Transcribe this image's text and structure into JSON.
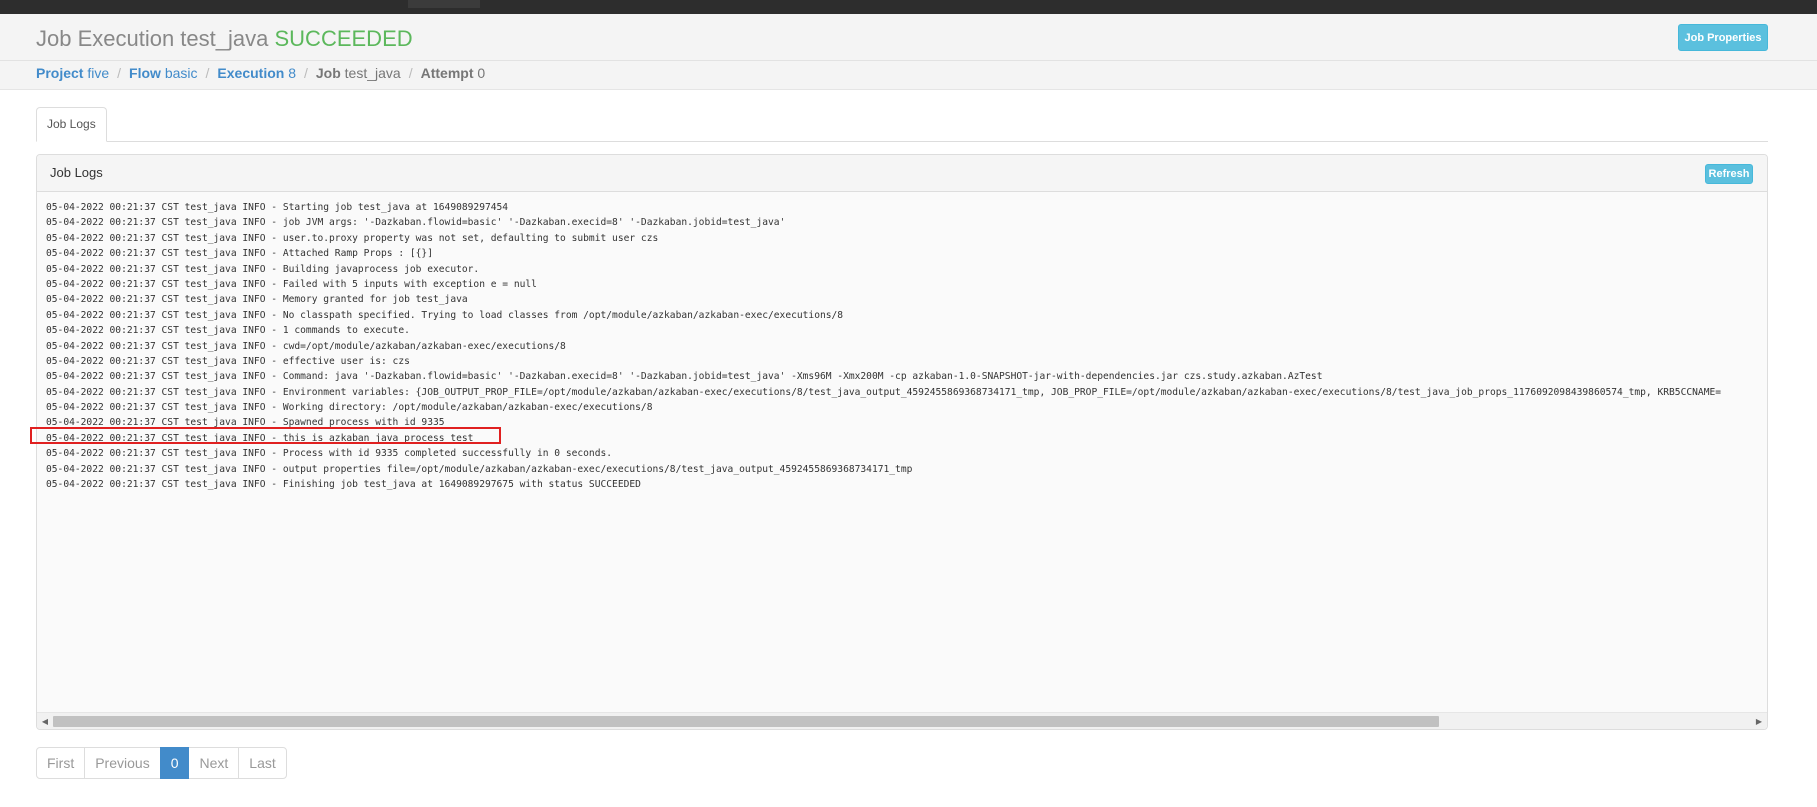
{
  "header": {
    "title_prefix": "Job Execution test_java",
    "status": "SUCCEEDED",
    "job_properties_label": "Job Properties"
  },
  "breadcrumb": {
    "project_label": "Project",
    "project_value": "five",
    "flow_label": "Flow",
    "flow_value": "basic",
    "execution_label": "Execution",
    "execution_value": "8",
    "job_label": "Job",
    "job_value": "test_java",
    "attempt_label": "Attempt",
    "attempt_value": "0"
  },
  "tabs": {
    "active_label": "Job Logs"
  },
  "panel": {
    "title": "Job Logs",
    "refresh_label": "Refresh"
  },
  "logs": {
    "lines": [
      "05-04-2022 00:21:37 CST test_java INFO - Starting job test_java at 1649089297454",
      "05-04-2022 00:21:37 CST test_java INFO - job JVM args: '-Dazkaban.flowid=basic' '-Dazkaban.execid=8' '-Dazkaban.jobid=test_java'",
      "05-04-2022 00:21:37 CST test_java INFO - user.to.proxy property was not set, defaulting to submit user czs",
      "05-04-2022 00:21:37 CST test_java INFO - Attached Ramp Props : [{}]",
      "05-04-2022 00:21:37 CST test_java INFO - Building javaprocess job executor.",
      "05-04-2022 00:21:37 CST test_java INFO - Failed with 5 inputs with exception e = null",
      "05-04-2022 00:21:37 CST test_java INFO - Memory granted for job test_java",
      "05-04-2022 00:21:37 CST test_java INFO - No classpath specified. Trying to load classes from /opt/module/azkaban/azkaban-exec/executions/8",
      "05-04-2022 00:21:37 CST test_java INFO - 1 commands to execute.",
      "05-04-2022 00:21:37 CST test_java INFO - cwd=/opt/module/azkaban/azkaban-exec/executions/8",
      "05-04-2022 00:21:37 CST test_java INFO - effective user is: czs",
      "05-04-2022 00:21:37 CST test_java INFO - Command: java '-Dazkaban.flowid=basic' '-Dazkaban.execid=8' '-Dazkaban.jobid=test_java' -Xms96M -Xmx200M -cp azkaban-1.0-SNAPSHOT-jar-with-dependencies.jar czs.study.azkaban.AzTest",
      "05-04-2022 00:21:37 CST test_java INFO - Environment variables: {JOB_OUTPUT_PROP_FILE=/opt/module/azkaban/azkaban-exec/executions/8/test_java_output_4592455869368734171_tmp, JOB_PROP_FILE=/opt/module/azkaban/azkaban-exec/executions/8/test_java_job_props_1176092098439860574_tmp, KRB5CCNAME=",
      "05-04-2022 00:21:37 CST test_java INFO - Working directory: /opt/module/azkaban/azkaban-exec/executions/8",
      "05-04-2022 00:21:37 CST test_java INFO - Spawned process with id 9335",
      "05-04-2022 00:21:37 CST test_java INFO - this is azkaban java process test",
      "05-04-2022 00:21:37 CST test_java INFO - Process with id 9335 completed successfully in 0 seconds.",
      "05-04-2022 00:21:37 CST test_java INFO - output properties file=/opt/module/azkaban/azkaban-exec/executions/8/test_java_output_4592455869368734171_tmp",
      "05-04-2022 00:21:37 CST test_java INFO - Finishing job test_java at 1649089297675 with status SUCCEEDED"
    ],
    "highlighted_line": 15
  },
  "pagination": {
    "first": "First",
    "previous": "Previous",
    "current": "0",
    "next": "Next",
    "last": "Last"
  },
  "icons": {
    "scroll_left": "scroll-left-arrow-icon",
    "scroll_right": "scroll-right-arrow-icon"
  },
  "colors": {
    "status_success": "#5cb85c",
    "link": "#428bca",
    "info_button": "#5bc0de",
    "highlight": "#e02020"
  }
}
